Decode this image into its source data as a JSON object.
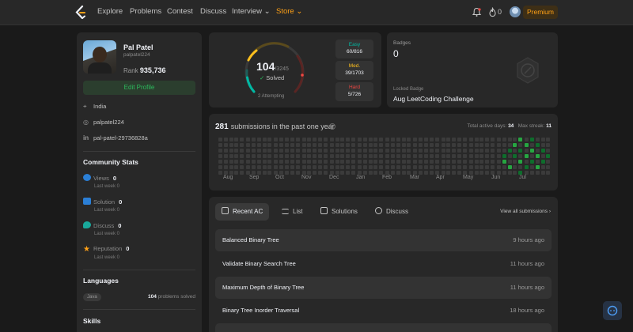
{
  "nav": {
    "items": [
      {
        "label": "Explore"
      },
      {
        "label": "Problems"
      },
      {
        "label": "Contest"
      },
      {
        "label": "Discuss"
      },
      {
        "label": "Interview ⌄"
      },
      {
        "label": "Store ⌄"
      }
    ],
    "streak_count": "0",
    "premium_label": "Premium"
  },
  "profile": {
    "name": "Pal Patel",
    "handle": "palpatel224",
    "rank_label": "Rank",
    "rank_value": "935,736",
    "edit_label": "Edit Profile",
    "location": "India",
    "github": "palpatel224",
    "linkedin": "pal-patel-29736828a"
  },
  "community": {
    "title": "Community Stats",
    "stats": [
      {
        "label": "Views",
        "value": "0",
        "sub": "Last week 0"
      },
      {
        "label": "Solution",
        "value": "0",
        "sub": "Last week 0"
      },
      {
        "label": "Discuss",
        "value": "0",
        "sub": "Last week 0"
      },
      {
        "label": "Reputation",
        "value": "0",
        "sub": "Last week 0"
      }
    ]
  },
  "languages": {
    "title": "Languages",
    "lang": "Java",
    "count": "104",
    "count_suffix": "problems solved"
  },
  "skills": {
    "title": "Skills"
  },
  "solved": {
    "count": "104",
    "total": "/3245",
    "label": "Solved",
    "attempting": "2 Attempting",
    "progress_fraction": 0.032,
    "easy": {
      "label": "Easy",
      "value": "60/816"
    },
    "medium": {
      "label": "Med.",
      "value": "39/1703"
    },
    "hard": {
      "label": "Hard",
      "value": "5/726"
    }
  },
  "badges": {
    "label": "Badges",
    "count": "0",
    "locked_label": "Locked Badge",
    "locked_name": "Aug LeetCoding Challenge"
  },
  "heatmap": {
    "count": "281",
    "title_suffix": "submissions in the past one year",
    "active_label": "Total active days:",
    "active_value": "34",
    "streak_label": "Max streak:",
    "streak_value": "11",
    "months": [
      "Aug",
      "Sep",
      "Oct",
      "Nov",
      "Dec",
      "Jan",
      "Feb",
      "Mar",
      "Apr",
      "May",
      "Jun",
      "Jul"
    ]
  },
  "recent": {
    "tabs": [
      {
        "label": "Recent AC"
      },
      {
        "label": "List"
      },
      {
        "label": "Solutions"
      },
      {
        "label": "Discuss"
      }
    ],
    "view_all": "View all submissions ›",
    "rows": [
      {
        "title": "Balanced Binary Tree",
        "ago": "9 hours ago"
      },
      {
        "title": "Validate Binary Search Tree",
        "ago": "11 hours ago"
      },
      {
        "title": "Maximum Depth of Binary Tree",
        "ago": "11 hours ago"
      },
      {
        "title": "Binary Tree Inorder Traversal",
        "ago": "18 hours ago"
      }
    ]
  },
  "colors": {
    "accent": "#ffa116",
    "easy": "#00b8a3",
    "medium": "#ffc01e",
    "hard": "#ef4743",
    "green": "#2cbb5d"
  },
  "icons": [
    "logo-icon",
    "bell-icon",
    "fire-icon",
    "location-icon",
    "github-icon",
    "linkedin-icon",
    "eye-icon",
    "check-icon",
    "chat-icon",
    "star-icon",
    "info-icon",
    "badge-icon",
    "help-chat-icon"
  ]
}
